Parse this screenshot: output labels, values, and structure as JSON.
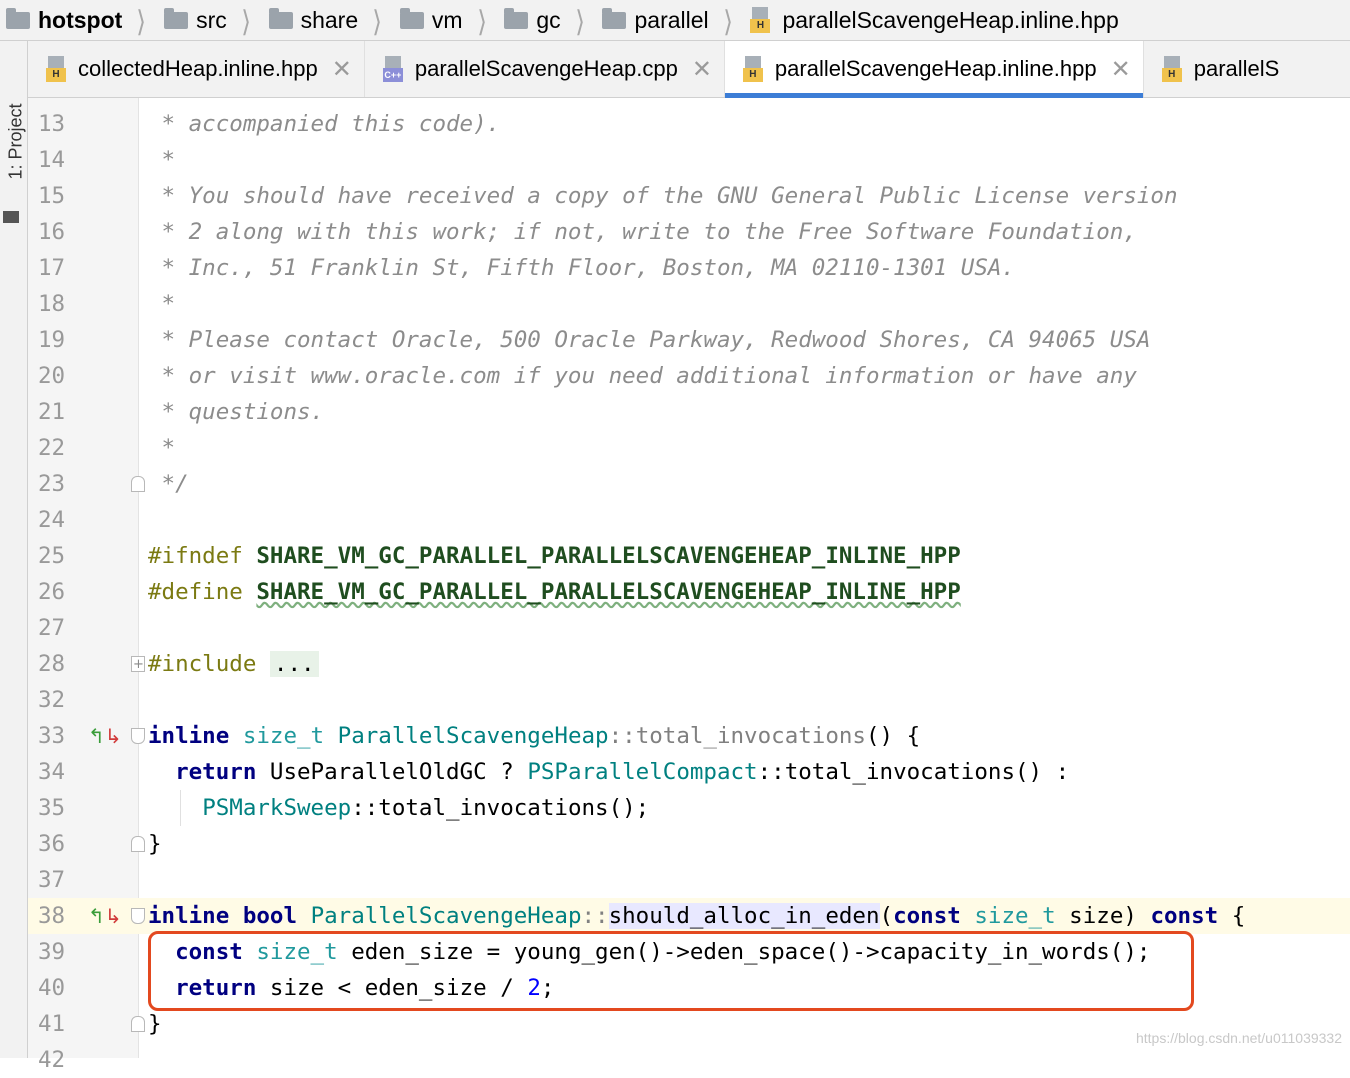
{
  "breadcrumb": [
    {
      "label": "hotspot",
      "icon": "folder-icon",
      "bold": true
    },
    {
      "label": "src",
      "icon": "folder-icon"
    },
    {
      "label": "share",
      "icon": "folder-icon"
    },
    {
      "label": "vm",
      "icon": "folder-icon"
    },
    {
      "label": "gc",
      "icon": "folder-icon"
    },
    {
      "label": "parallel",
      "icon": "folder-icon"
    },
    {
      "label": "parallelScavengeHeap.inline.hpp",
      "icon": "header-file-icon"
    }
  ],
  "left_strip": {
    "project_tab": "1: Project"
  },
  "tabs": [
    {
      "label": "collectedHeap.inline.hpp",
      "icon_tag": "H",
      "active": false
    },
    {
      "label": "parallelScavengeHeap.cpp",
      "icon_tag": "C++",
      "active": false
    },
    {
      "label": "parallelScavengeHeap.inline.hpp",
      "icon_tag": "H",
      "active": true
    },
    {
      "label": "parallelS",
      "icon_tag": "H",
      "active": false
    }
  ],
  "code": {
    "lines": [
      {
        "n": "13",
        "text": " * accompanied this code)."
      },
      {
        "n": "14",
        "text": " *"
      },
      {
        "n": "15",
        "text": " * You should have received a copy of the GNU General Public License version"
      },
      {
        "n": "16",
        "text": " * 2 along with this work; if not, write to the Free Software Foundation,"
      },
      {
        "n": "17",
        "text": " * Inc., 51 Franklin St, Fifth Floor, Boston, MA 02110-1301 USA."
      },
      {
        "n": "18",
        "text": " *"
      },
      {
        "n": "19",
        "text": " * Please contact Oracle, 500 Oracle Parkway, Redwood Shores, CA 94065 USA"
      },
      {
        "n": "20",
        "text": " * or visit www.oracle.com if you need additional information or have any"
      },
      {
        "n": "21",
        "text": " * questions."
      },
      {
        "n": "22",
        "text": " *"
      },
      {
        "n": "23",
        "text": " */"
      },
      {
        "n": "24",
        "text": ""
      },
      {
        "n": "25",
        "pp": "#ifndef",
        "macro": "SHARE_VM_GC_PARALLEL_PARALLELSCAVENGEHEAP_INLINE_HPP"
      },
      {
        "n": "26",
        "pp": "#define",
        "macro": "SHARE_VM_GC_PARALLEL_PARALLELSCAVENGEHEAP_INLINE_HPP"
      },
      {
        "n": "27",
        "text": ""
      },
      {
        "n": "28",
        "pp": "#include",
        "collapsed": "..."
      },
      {
        "n": "32",
        "text": ""
      },
      {
        "n": "33",
        "kw1": "inline",
        "type": "size_t",
        "cls": "ParallelScavengeHeap",
        "sep": "::",
        "fn": "total_invocations",
        "rest": "() {"
      },
      {
        "n": "34",
        "kw1": "return",
        "p1": " UseParallelOldGC ? ",
        "cls": "PSParallelCompact",
        "p2": "::total_invocations() :"
      },
      {
        "n": "35",
        "cls": "PSMarkSweep",
        "p2": "::total_invocations();"
      },
      {
        "n": "36",
        "text": "}"
      },
      {
        "n": "37",
        "text": ""
      },
      {
        "n": "38",
        "kw1": "inline",
        "kw2": "bool",
        "cls": "ParallelScavengeHeap",
        "sep": "::",
        "fn": "should_alloc_in_eden",
        "p1": "(",
        "kw3": "const",
        "type": "size_t",
        "p2": " size) ",
        "kw4": "const",
        "p3": " {"
      },
      {
        "n": "39",
        "kw1": "const",
        "type": "size_t",
        "p1": " eden_size = young_gen()->eden_space()->capacity_in_words();"
      },
      {
        "n": "40",
        "kw1": "return",
        "p1": " size < eden_size / ",
        "num": "2",
        "p2": ";"
      },
      {
        "n": "41",
        "text": "}"
      },
      {
        "n": "42",
        "text": ""
      }
    ]
  },
  "watermark": "https://blog.csdn.net/u011039332",
  "colors": {
    "accent": "#3c7dd6",
    "highlight_box": "#e3491f"
  }
}
